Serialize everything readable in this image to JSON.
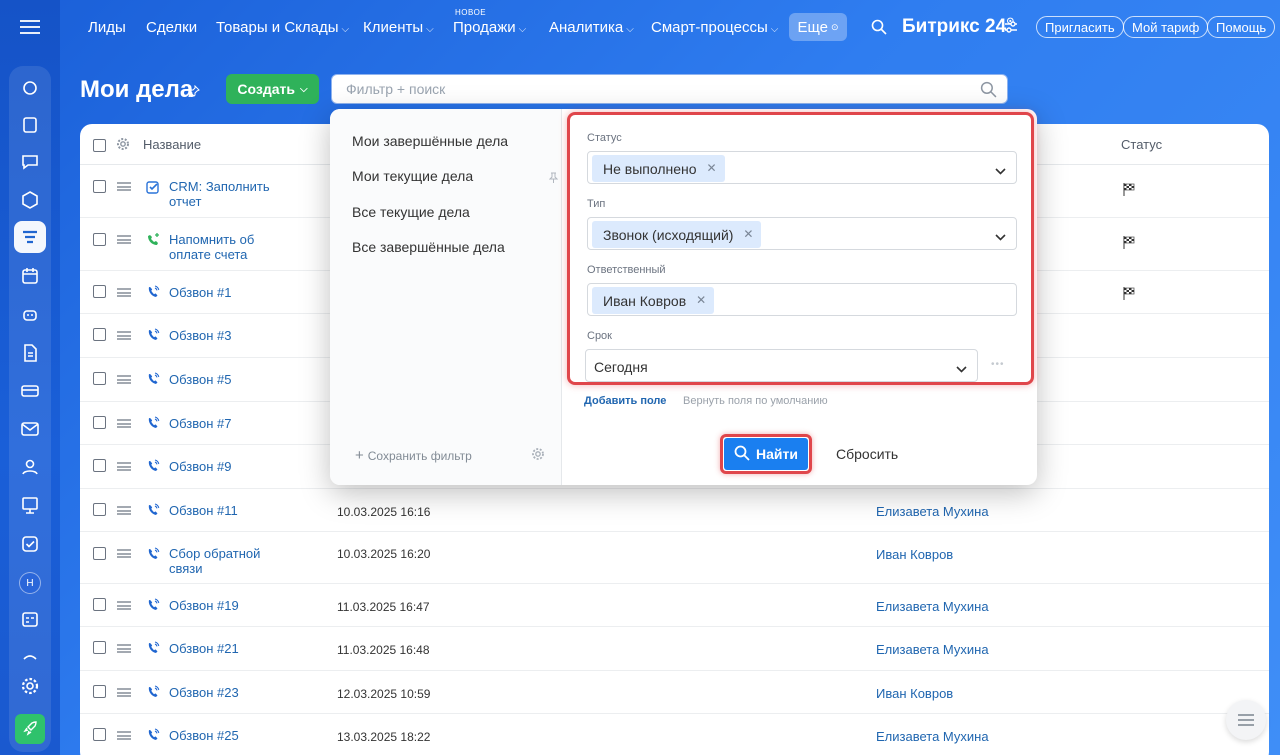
{
  "nav": {
    "items": [
      {
        "label": "Лиды",
        "chevron": false
      },
      {
        "label": "Сделки",
        "chevron": false
      },
      {
        "label": "Товары и Склады",
        "chevron": true
      },
      {
        "label": "Клиенты",
        "chevron": true
      },
      {
        "label": "Продажи",
        "chevron": true,
        "badge": "НОВОЕ"
      },
      {
        "label": "Аналитика",
        "chevron": true
      },
      {
        "label": "Смарт-процессы",
        "chevron": true
      }
    ],
    "more_label": "Еще",
    "brand": "Битрикс 24",
    "invite_label": "Пригласить",
    "tariff_label": "Мой тариф",
    "help_label": "Помощь"
  },
  "rail": {
    "avatar_letter": "Н",
    "icons": [
      "feed-icon",
      "tasks-icon",
      "chat-icon",
      "hexagon-icon",
      "crm-filter-icon",
      "calendar-icon",
      "robot-icon",
      "document-icon",
      "card-icon",
      "mail-icon",
      "contacts-icon",
      "presentation-icon",
      "checkbox-icon",
      "planner-icon",
      "collapse-icon",
      "settings-icon",
      "rocket-icon"
    ]
  },
  "header": {
    "title": "Мои дела",
    "create_label": "Создать",
    "filter_placeholder": "Фильтр + поиск"
  },
  "table": {
    "col_name": "Название",
    "col_status": "Статус",
    "rows": [
      {
        "type": "task",
        "name": "CRM: Заполнить отчет",
        "date": "",
        "resp": "",
        "flag": true
      },
      {
        "type": "reminder",
        "name": "Напомнить об оплате счета",
        "date": "",
        "resp": "",
        "flag": true
      },
      {
        "type": "call",
        "name": "Обзвон #1",
        "date": "",
        "resp": "",
        "flag": true
      },
      {
        "type": "call",
        "name": "Обзвон #3",
        "date": "",
        "resp": "",
        "flag": false
      },
      {
        "type": "call",
        "name": "Обзвон #5",
        "date": "",
        "resp": "",
        "flag": false
      },
      {
        "type": "call",
        "name": "Обзвон #7",
        "date": "",
        "resp": "",
        "flag": false
      },
      {
        "type": "call",
        "name": "Обзвон #9",
        "date": "",
        "resp": "",
        "flag": false
      },
      {
        "type": "call",
        "name": "Обзвон #11",
        "date": "10.03.2025 16:16",
        "resp": "Елизавета Мухина",
        "flag": false
      },
      {
        "type": "call",
        "name": "Сбор обратной связи",
        "date": "10.03.2025 16:20",
        "resp": "Иван Ковров",
        "flag": false
      },
      {
        "type": "call",
        "name": "Обзвон #19",
        "date": "11.03.2025 16:47",
        "resp": "Елизавета Мухина",
        "flag": false
      },
      {
        "type": "call",
        "name": "Обзвон #21",
        "date": "11.03.2025 16:48",
        "resp": "Елизавета Мухина",
        "flag": false
      },
      {
        "type": "call",
        "name": "Обзвон #23",
        "date": "12.03.2025 10:59",
        "resp": "Иван Ковров",
        "flag": false
      },
      {
        "type": "call",
        "name": "Обзвон #25",
        "date": "13.03.2025 18:22",
        "resp": "Елизавета Мухина",
        "flag": false
      }
    ]
  },
  "filter": {
    "presets": [
      "Мои завершённые дела",
      "Мои текущие дела",
      "Все текущие дела",
      "Все завершённые дела"
    ],
    "save_filter": "Сохранить фильтр",
    "fields": {
      "status_label": "Статус",
      "status_value": "Не выполнено",
      "type_label": "Тип",
      "type_value": "Звонок (исходящий)",
      "resp_label": "Ответственный",
      "resp_value": "Иван Ковров",
      "deadline_label": "Срок",
      "deadline_value": "Сегодня"
    },
    "add_field": "Добавить поле",
    "reset_fields": "Вернуть поля по умолчанию",
    "find_label": "Найти",
    "reset_label": "Сбросить"
  },
  "colors": {
    "accent": "#1a7ff0",
    "create": "#2fb25a",
    "highlight": "#e0464b",
    "link": "#2066b0"
  }
}
